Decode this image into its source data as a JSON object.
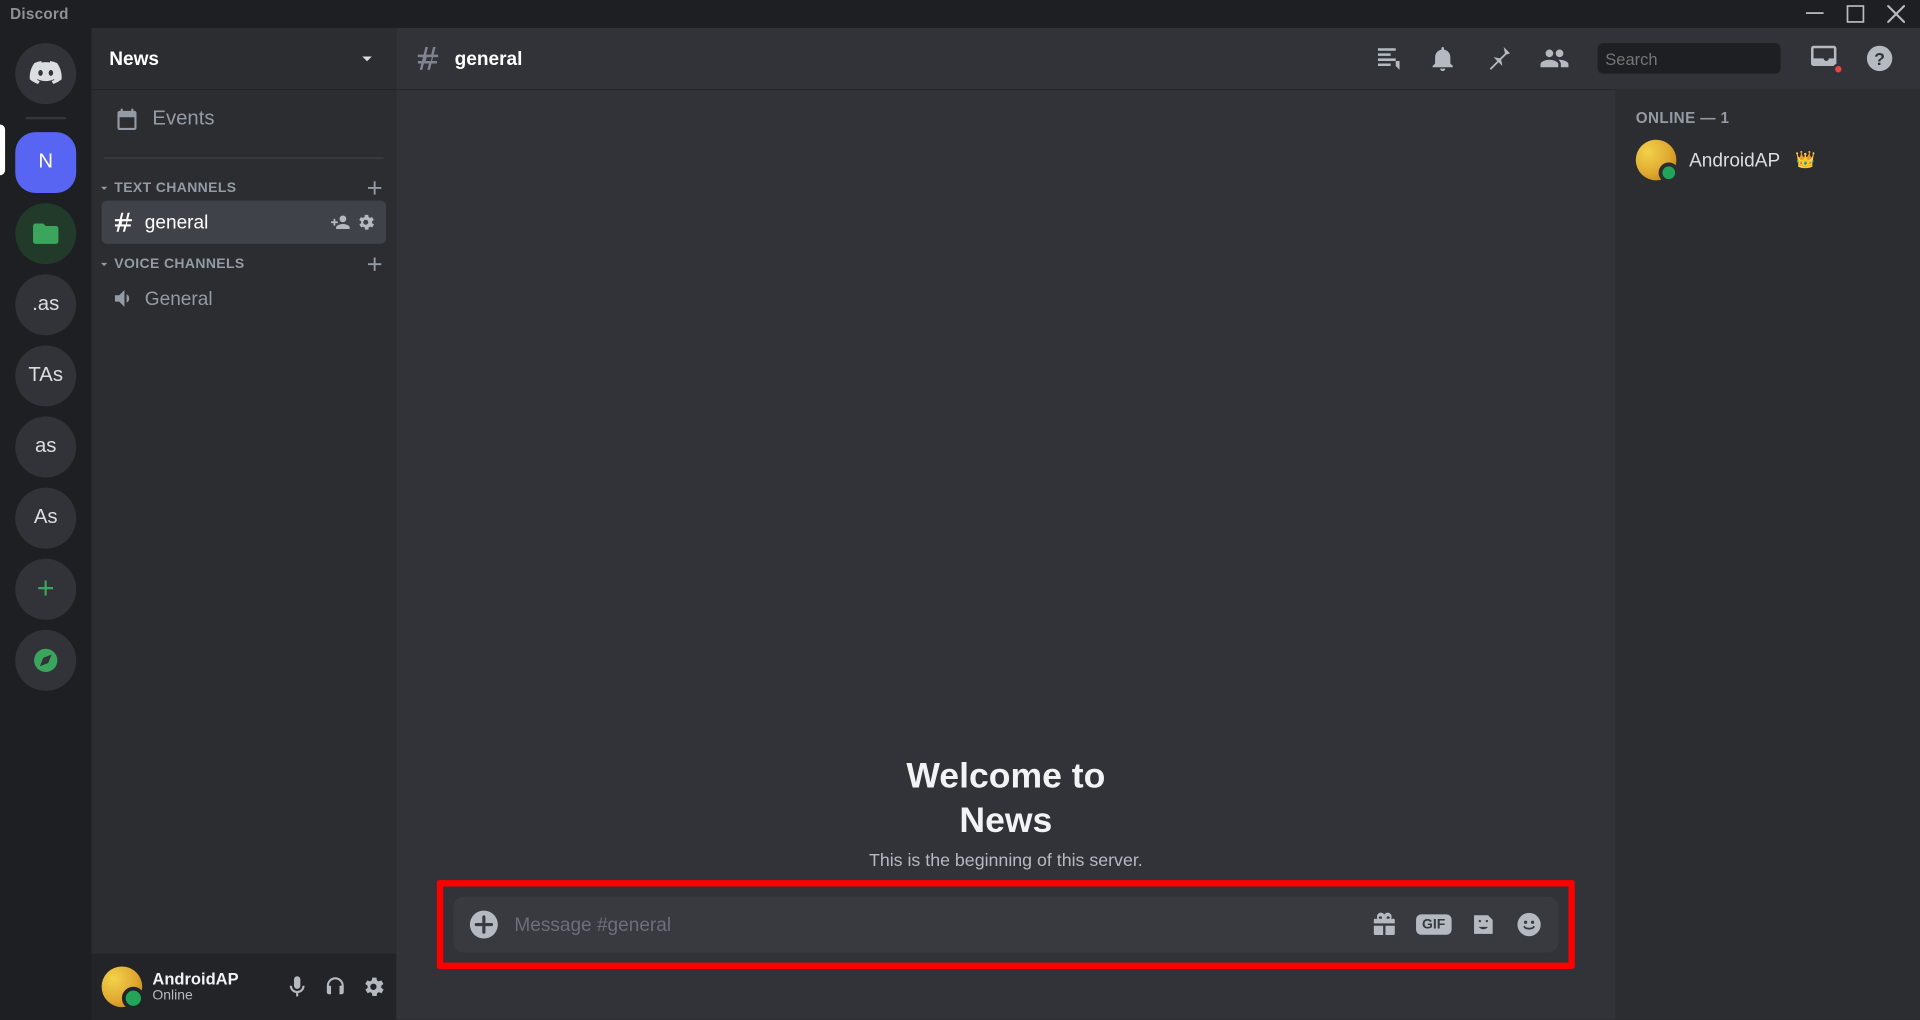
{
  "titlebar": {
    "brand": "Discord"
  },
  "servers": {
    "active_index": 1,
    "items": [
      {
        "type": "home"
      },
      {
        "type": "text",
        "label": "N",
        "active": true
      },
      {
        "type": "folder"
      },
      {
        "type": "text",
        "label": ".as"
      },
      {
        "type": "text",
        "label": "TAs"
      },
      {
        "type": "text",
        "label": "as"
      },
      {
        "type": "text",
        "label": "As"
      },
      {
        "type": "add"
      },
      {
        "type": "discover"
      }
    ]
  },
  "channel_sidebar": {
    "server_name": "News",
    "events_label": "Events",
    "categories": [
      {
        "label": "TEXT CHANNELS",
        "channels": [
          {
            "kind": "text",
            "name": "general",
            "active": true
          }
        ]
      },
      {
        "label": "VOICE CHANNELS",
        "channels": [
          {
            "kind": "voice",
            "name": "General",
            "active": false
          }
        ]
      }
    ]
  },
  "user_area": {
    "name": "AndroidAP",
    "status": "Online"
  },
  "chat": {
    "channel_name": "general",
    "search_placeholder": "Search",
    "welcome_line1": "Welcome to",
    "welcome_line2": "News",
    "welcome_sub": "This is the beginning of this server.",
    "input_placeholder": "Message #general"
  },
  "members_panel": {
    "heading": "ONLINE — 1",
    "members": [
      {
        "name": "AndroidAP",
        "owner": true
      }
    ]
  }
}
